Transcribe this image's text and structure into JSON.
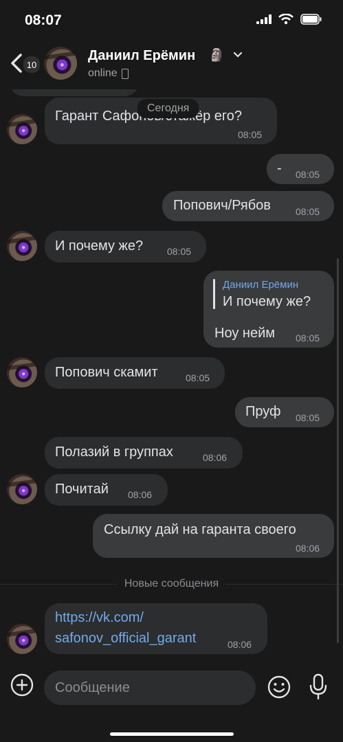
{
  "status_bar": {
    "time": "08:07"
  },
  "header": {
    "back_badge": "10",
    "contact_name": "Даниил Ерёмин",
    "status": "online"
  },
  "chat": {
    "date_label": "Сегодня",
    "new_messages_label": "Новые сообщения",
    "messages": [
      {
        "direction": "in",
        "text": "Гарант Сафонов/стажёр его?",
        "time": "08:05"
      },
      {
        "direction": "out",
        "text": "-",
        "time": "08:05"
      },
      {
        "direction": "out",
        "text": "Попович/Рябов",
        "time": "08:05"
      },
      {
        "direction": "in",
        "text": "И почему же?",
        "time": "08:05"
      },
      {
        "direction": "out",
        "reply_to_name": "Даниил Ерёмин",
        "reply_to_text": "И почему же?",
        "text": "Ноу нейм",
        "time": "08:05"
      },
      {
        "direction": "in",
        "text": "Попович скамит",
        "time": "08:05"
      },
      {
        "direction": "out",
        "text": "Пруф",
        "time": "08:05"
      },
      {
        "direction": "in",
        "text": "Полазий в группах",
        "time": "08:06"
      },
      {
        "direction": "in",
        "text": "Почитай",
        "time": "08:06"
      },
      {
        "direction": "out",
        "text": "Ссылку дай на гаранта своего",
        "time": "08:06"
      },
      {
        "direction": "in",
        "link_line1": "https://vk.com/",
        "link_line2": "safonov_official_garant",
        "time": "08:06"
      }
    ]
  },
  "composer": {
    "placeholder": "Сообщение"
  },
  "colors": {
    "background": "#191919",
    "bubble_in": "#2c2d2e",
    "bubble_out": "#3a3b3c",
    "link": "#71aaeb"
  }
}
